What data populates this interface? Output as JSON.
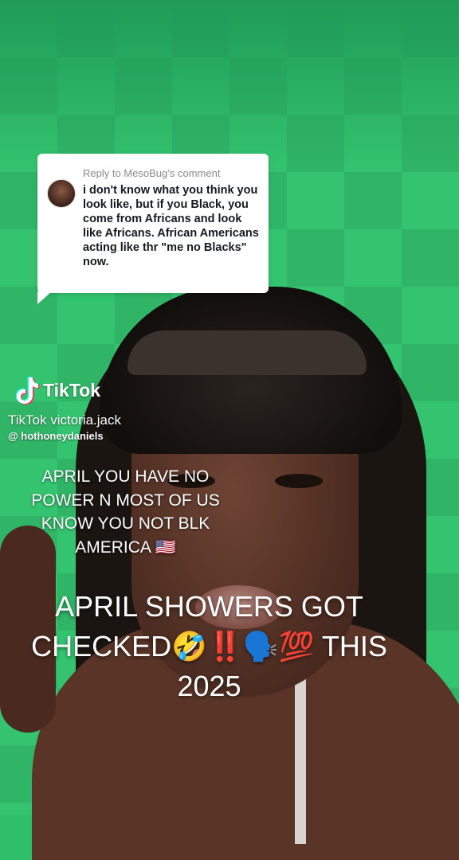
{
  "reply": {
    "header": "Reply to MesoBug’s comment",
    "text": "i don't know what you think you look like, but if you Black, you come from Africans and look like Africans. African Americans acting like thr \"me no Blacks\" now."
  },
  "watermark": {
    "brand": "TikTok",
    "user_line_1": "TikTok victoria.jack",
    "user_line_2": "@ hothoneydaniels"
  },
  "caption_small": {
    "lines": [
      "APRIL YOU HAVE NO",
      "POWER N MOST OF US",
      "KNOW YOU NOT BLK",
      "AMERICA 🇺🇸"
    ]
  },
  "caption_big": {
    "lines": [
      "APRIL SHOWERS GOT",
      "CHECKED🤣‼️🗣️💯 THIS",
      "2025"
    ]
  },
  "colors": {
    "background": "#34c46f",
    "card": "#ffffff",
    "caption": "#ffffff"
  },
  "icons": {
    "tiktok_logo": "tiktok-note-icon"
  }
}
